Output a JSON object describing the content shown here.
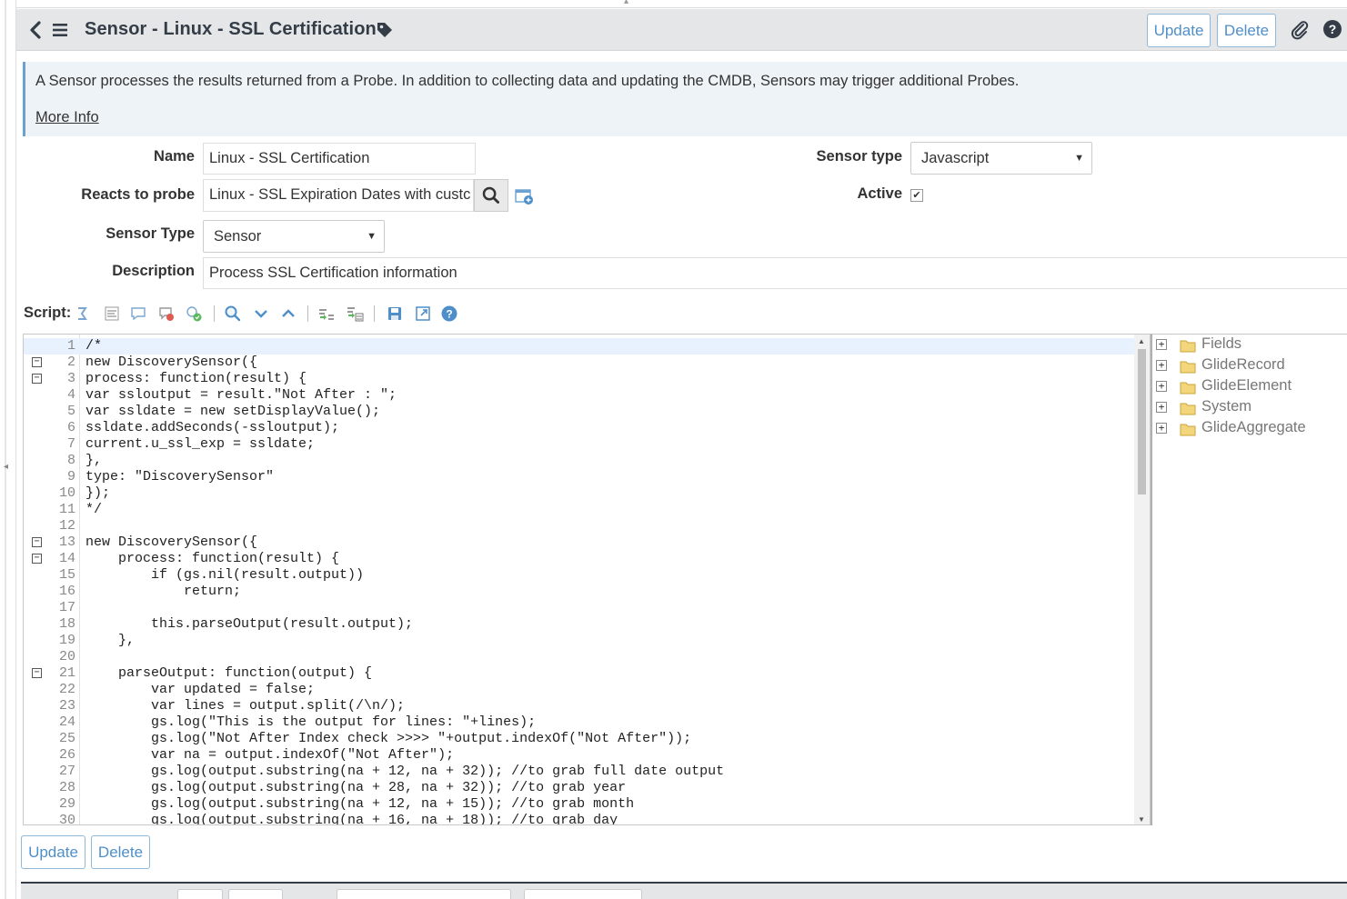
{
  "header": {
    "title": "Sensor - Linux - SSL Certification",
    "update_label": "Update",
    "delete_label": "Delete",
    "help_glyph": "?"
  },
  "info": {
    "message": "A Sensor processes the results returned from a Probe. In addition to collecting data and updating the CMDB, Sensors may trigger additional Probes.",
    "more_info": "More Info"
  },
  "form": {
    "name_label": "Name",
    "name_value": "Linux - SSL Certification",
    "probe_label": "Reacts to probe",
    "probe_value": "Linux - SSL Expiration Dates with custc",
    "sensor_type_label": "Sensor Type",
    "sensor_type_value": "Sensor",
    "description_label": "Description",
    "description_value": "Process SSL Certification information",
    "sensor_type2_label": "Sensor type",
    "sensor_type2_value": "Javascript",
    "active_label": "Active",
    "active_checked": true,
    "check_glyph": "✔"
  },
  "script": {
    "label": "Script:",
    "lines": [
      {
        "n": "1",
        "code": "/*"
      },
      {
        "n": "2",
        "code": "new DiscoverySensor({"
      },
      {
        "n": "3",
        "code": "process: function(result) {"
      },
      {
        "n": "4",
        "code": "var ssloutput = result.\"Not After : \";"
      },
      {
        "n": "5",
        "code": "var ssldate = new setDisplayValue();"
      },
      {
        "n": "6",
        "code": "ssldate.addSeconds(-ssloutput);"
      },
      {
        "n": "7",
        "code": "current.u_ssl_exp = ssldate;"
      },
      {
        "n": "8",
        "code": "},"
      },
      {
        "n": "9",
        "code": "type: \"DiscoverySensor\""
      },
      {
        "n": "10",
        "code": "});"
      },
      {
        "n": "11",
        "code": "*/"
      },
      {
        "n": "12",
        "code": ""
      },
      {
        "n": "13",
        "code": "new DiscoverySensor({"
      },
      {
        "n": "14",
        "code": "    process: function(result) {"
      },
      {
        "n": "15",
        "code": "        if (gs.nil(result.output))"
      },
      {
        "n": "16",
        "code": "            return;"
      },
      {
        "n": "17",
        "code": ""
      },
      {
        "n": "18",
        "code": "        this.parseOutput(result.output);"
      },
      {
        "n": "19",
        "code": "    },"
      },
      {
        "n": "20",
        "code": ""
      },
      {
        "n": "21",
        "code": "    parseOutput: function(output) {"
      },
      {
        "n": "22",
        "code": "        var updated = false;"
      },
      {
        "n": "23",
        "code": "        var lines = output.split(/\\n/);"
      },
      {
        "n": "24",
        "code": "        gs.log(\"This is the output for lines: \"+lines);"
      },
      {
        "n": "25",
        "code": "        gs.log(\"Not After Index check >>>> \"+output.indexOf(\"Not After\"));"
      },
      {
        "n": "26",
        "code": "        var na = output.indexOf(\"Not After\");"
      },
      {
        "n": "27",
        "code": "        gs.log(output.substring(na + 12, na + 32)); //to grab full date output"
      },
      {
        "n": "28",
        "code": "        gs.log(output.substring(na + 28, na + 32)); //to grab year"
      },
      {
        "n": "29",
        "code": "        gs.log(output.substring(na + 12, na + 15)); //to grab month"
      },
      {
        "n": "30",
        "code": "        gs.log(output.substring(na + 16, na + 18)); //to grab day"
      }
    ],
    "fold_lines": [
      "2",
      "3",
      "13",
      "14",
      "21"
    ],
    "fold_glyph": "−"
  },
  "tree": {
    "items": [
      {
        "label": "Fields"
      },
      {
        "label": "GlideRecord"
      },
      {
        "label": "GlideElement"
      },
      {
        "label": "System"
      },
      {
        "label": "GlideAggregate"
      }
    ],
    "expand_glyph": "+"
  },
  "footer": {
    "update_label": "Update",
    "delete_label": "Delete"
  }
}
